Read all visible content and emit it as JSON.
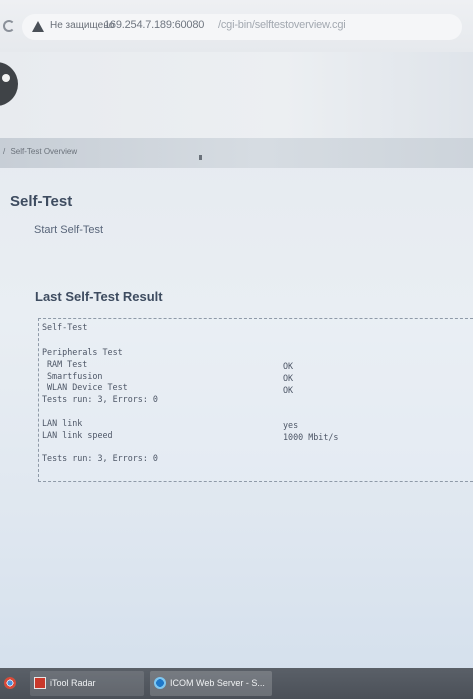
{
  "browser": {
    "security_warning": "Не защищено",
    "url_host": "169.254.7.189:60080",
    "url_path": "/cgi-bin/selftestoverview.cgi"
  },
  "breadcrumb": {
    "separator": "/",
    "current": "Self-Test Overview"
  },
  "page": {
    "title": "Self-Test",
    "start_link": "Start Self-Test",
    "section_title": "Last Self-Test Result"
  },
  "result": {
    "header": "Self-Test",
    "peripherals": {
      "heading": "Peripherals Test",
      "items": [
        {
          "label": "RAM Test",
          "value": "OK"
        },
        {
          "label": "Smartfusion",
          "value": "OK"
        },
        {
          "label": "WLAN Device Test",
          "value": "OK"
        }
      ],
      "summary": "Tests run: 3, Errors: 0"
    },
    "lan": {
      "items": [
        {
          "label": "LAN link",
          "value": "yes"
        },
        {
          "label": "LAN link speed",
          "value": "1000 Mbit/s"
        }
      ],
      "summary": "Tests run: 3, Errors: 0"
    }
  },
  "taskbar": {
    "items": [
      {
        "label": "iTool Radar",
        "icon": "radar-icon"
      },
      {
        "label": "ICOM Web Server - S...",
        "icon": "browser-icon"
      }
    ]
  },
  "colors": {
    "title": "#3e4c60",
    "taskbar": "#50555d"
  }
}
